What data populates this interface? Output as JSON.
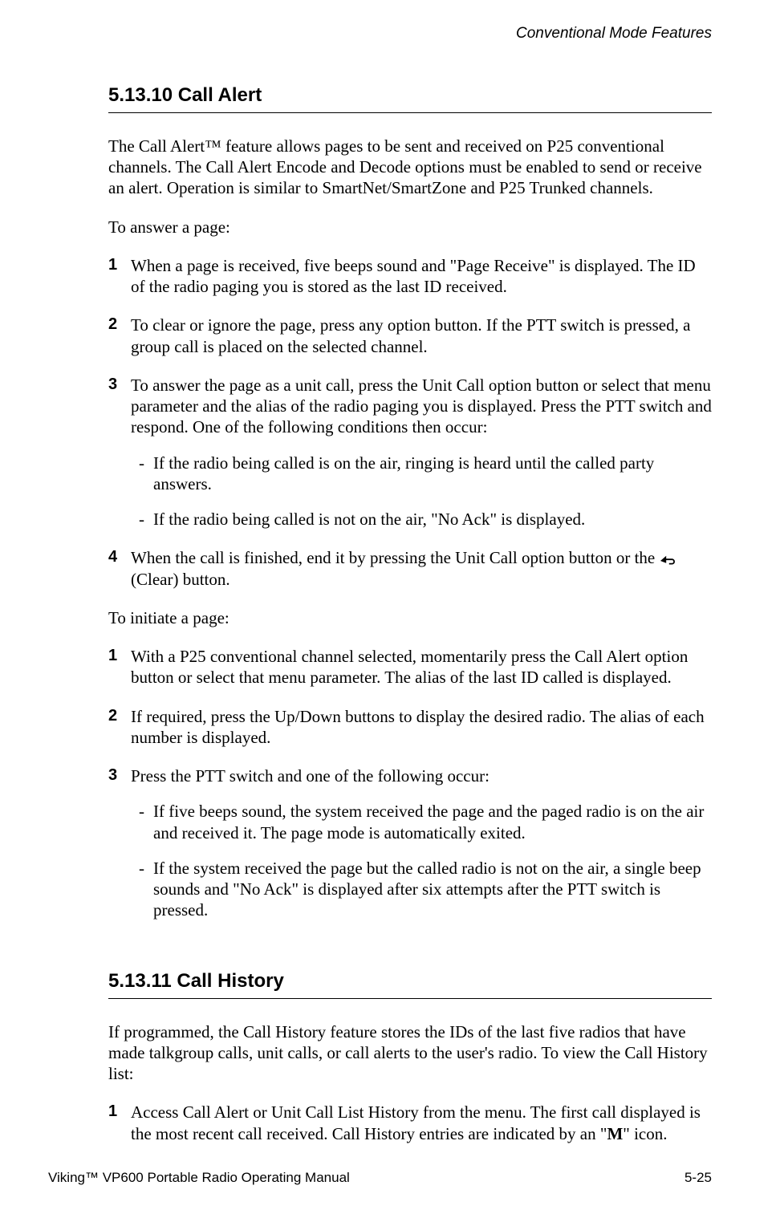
{
  "header": {
    "chapter_title": "Conventional Mode Features"
  },
  "sections": [
    {
      "number": "5.13.10",
      "title": "Call Alert",
      "intro": "The Call Alert™ feature allows pages to be sent and received on P25 conventional channels. The Call Alert Encode and Decode options must be enabled to send or receive an alert. Operation is similar to SmartNet/SmartZone and P25 Trunked channels.",
      "groups": [
        {
          "lead": "To answer a page:",
          "items": [
            {
              "n": "1",
              "text": "When a page is received, five beeps sound and \"Page Receive\" is displayed. The ID of the radio paging you is stored as the last ID received."
            },
            {
              "n": "2",
              "text": "To clear or ignore the page, press any option button. If the PTT switch is pressed, a group call is placed on the selected channel."
            },
            {
              "n": "3",
              "text": "To answer the page as a unit call, press the Unit Call option button or select that menu parameter and the alias of the radio paging you is displayed. Press the PTT switch and respond. One of the following conditions then occur:",
              "subs": [
                "If the radio being called is on the air, ringing is heard until the called party answers.",
                "If the radio being called is not on the air, \"No Ack\" is displayed."
              ]
            },
            {
              "n": "4",
              "text_pre": "When the call is finished, end it by pressing the Unit Call option button or the ",
              "text_post": " (Clear) button.",
              "has_icon": true
            }
          ]
        },
        {
          "lead": "To initiate a page:",
          "items": [
            {
              "n": "1",
              "text": "With a P25 conventional channel selected, momentarily press the Call Alert option button or select that menu parameter. The alias of the last ID called is displayed."
            },
            {
              "n": "2",
              "text": "If required, press the Up/Down buttons to display the desired radio. The alias of each number is displayed."
            },
            {
              "n": "3",
              "text": "Press the PTT switch and one of the following occur:",
              "subs": [
                "If five beeps sound, the system received the page and the paged radio is on the air and received it. The page mode is automatically exited.",
                "If the system received the page but the called radio is not on the air, a single beep sounds and \"No Ack\" is displayed after six attempts after the PTT switch is pressed."
              ]
            }
          ]
        }
      ]
    },
    {
      "number": "5.13.11",
      "title": "Call History",
      "intro": "If programmed, the Call History feature stores the IDs of the last five radios that have made talkgroup calls, unit calls, or call alerts to the user's radio. To view the Call History list:",
      "groups": [
        {
          "items": [
            {
              "n": "1",
              "text_pre": "Access Call Alert or Unit Call List History from the menu. The first call displayed is the most recent call received. Call History entries are indicated by an \"",
              "bold": "M",
              "text_post": "\" icon."
            }
          ]
        }
      ]
    }
  ],
  "footer": {
    "left": "Viking™ VP600 Portable Radio Operating Manual",
    "right": "5-25"
  }
}
